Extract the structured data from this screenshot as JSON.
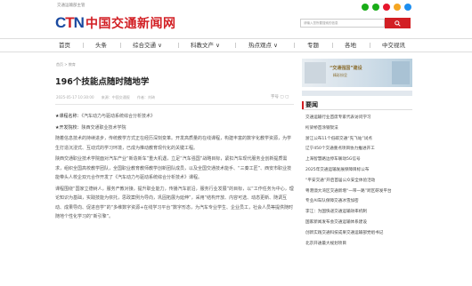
{
  "top_note": "交通运输部主管",
  "logo": {
    "ctn": "CTN",
    "cn": "中国交通新闻网"
  },
  "social_colors": [
    "#1aad19",
    "#1aad19",
    "#e6162d",
    "#f5a623",
    "#1d8ff0"
  ],
  "search": {
    "placeholder": "请输入您所要搜索的信息",
    "button_icon": "search-icon"
  },
  "nav": [
    "首页",
    "头条",
    "综合交通",
    "科教文产",
    "热点观点",
    "专题",
    "各地",
    "中交视讯"
  ],
  "breadcrumb": "首页 > 教育",
  "article": {
    "title": "196个技能点随时随地学",
    "date": "2025-05-17 10:30:00",
    "source": "来源：中国交通报",
    "author": "作者：刘琦",
    "font_size_label": "字号 ▢ ▢",
    "paragraphs": [
      {
        "label": "★课程名称：",
        "text": "《汽车动力与驱动系统综合分析技术》"
      },
      {
        "label": "★开发院校：",
        "text": "陕西交通职业技术学院"
      },
      {
        "label": "",
        "text": "随着信息技术的持续进步，传统教学方式正在经历深刻变革。开发高质量的在线课程，构建丰富的数字化教学资源，为学生打造沉浸式、互动式的学习环境，已成为推动教育现代化的关键工程。"
      },
      {
        "label": "",
        "text": "陕西交通职业技术学院面对汽车产业“新造新车”重大机遇，立足“汽车强国”战略目标，紧扣汽车现代服务业创新提质需求，组织全国高校教学团队，全国职业教育教师教学创新团队成员，以及全国交通技术能手、“三秦工匠”、西安市职业技能带头人校企双元合作开发了《汽车动力与驱动系统综合分析技术》课程。"
      },
      {
        "label": "",
        "text": "课程围绕“国家立德树人，服务产教对接，提升职业能力，传播汽车前沿，服务行业发展”的目标，以“工作任务为中心，理论知识为基础，实践技能为依托，思政案例为导向，巩固拓展为延伸”，采用“结构开放、内容可选、动态更新、随调互动、成果导向、促进自学”的“多维数字资源+在线学习平台”数字形态，为汽车专业学生、企业员工，社会人员等提供随时随地个性化学习的“新引擎”。"
      }
    ]
  },
  "banner": {
    "title": "“交通强国”建设",
    "subtitle": "精彩纷呈"
  },
  "sidebar": {
    "heading": "要闻",
    "items": [
      "交通运输行业首席专家代表访问学习",
      "桁梁桥首涂钢架法",
      "浙江公布11个低碳交通“先飞站”试点",
      "辽宁450个交通重点项目协力推进开工",
      "上海智慧路边停车联动5G信号",
      "2025年交通运输发展保障目标公布",
      "“平安交通”开启首届公众安全体验活动",
      "粤港澳大湾区交通新增“一带一路”跨区研发平台",
      "专业AI车队保障交通冰雪加密",
      "李江：为国快递交通运输效率机制",
      "国家新闻发布会交通运输体系建设",
      "创新实践交通科技成果交通运输部党组书记",
      "北京开通最大规划项目"
    ]
  }
}
